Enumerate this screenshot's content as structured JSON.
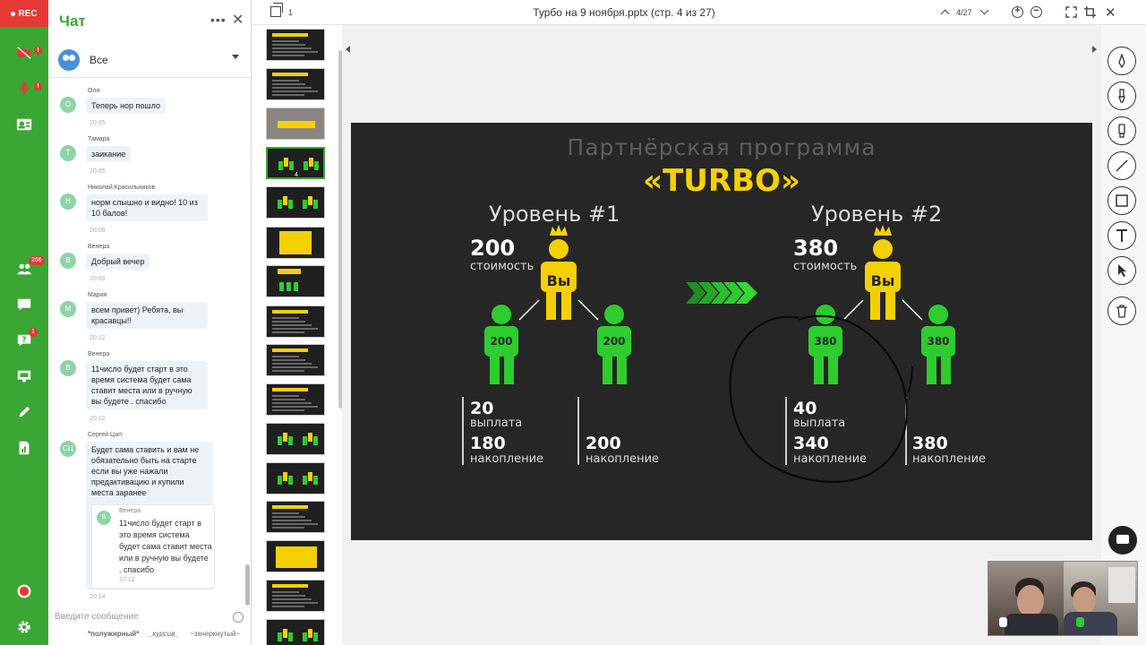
{
  "rail": {
    "rec_label": "REC",
    "users_badge": "266",
    "question_badge": "1"
  },
  "chat": {
    "title": "Чат",
    "recipient": "Все",
    "messages": [
      {
        "initial": "О",
        "author": "Оля",
        "text": "Теперь нор пошло",
        "time": "20:05"
      },
      {
        "initial": "Т",
        "author": "Тамара",
        "text": "заикание",
        "time": "20:05"
      },
      {
        "initial": "Н",
        "author": "Николай Красильников",
        "text": "норм слышно и видно! 10 из 10 балов!",
        "time": "20:08"
      },
      {
        "initial": "В",
        "author": "Венера",
        "text": "Добрый вечер",
        "time": "20:09"
      },
      {
        "initial": "М",
        "author": "Мария",
        "text": "всем привет) Ребята, вы красавцы!!",
        "time": "20:12"
      },
      {
        "initial": "В",
        "author": "Венера",
        "text": "11число будет старт в это время система будет сама ставит места или в ручную вы будете . спасибо",
        "time": "20:12"
      },
      {
        "initial": "СЦ",
        "author": "Сергей Цап",
        "text": "Будет сама ставить и вам не обязательно быть на старте если вы уже нажали предактивацию и купили места заранее",
        "time": "20:14",
        "quote": {
          "initial": "В",
          "author": "Венера",
          "text": "11число будет старт в это время система будет сама ставит места или в ручную вы будете . спасибо",
          "time": "17:12"
        }
      }
    ],
    "input_placeholder": "Введите сообщение",
    "format_bold": "*полужирный*",
    "format_italic": "_курсив_",
    "format_strike": "~зачеркнутый~"
  },
  "toolbar": {
    "pages_count": "1",
    "doc_title": "Турбо на 9 ноября.pptx (стр. 4 из 27)",
    "page_indicator": "4/27"
  },
  "thumbnails": [
    {
      "kind": "text",
      "title": "ПРЕИМУЩЕСТВА:"
    },
    {
      "kind": "text",
      "title": "ПРЕИМУЩЕСТВА:"
    },
    {
      "kind": "logo",
      "title": "«TURBO»"
    },
    {
      "kind": "levels",
      "num": "4",
      "active": true
    },
    {
      "kind": "levels"
    },
    {
      "kind": "promo"
    },
    {
      "kind": "people"
    },
    {
      "kind": "text"
    },
    {
      "kind": "text"
    },
    {
      "kind": "text"
    },
    {
      "kind": "levels"
    },
    {
      "kind": "levels"
    },
    {
      "kind": "text"
    },
    {
      "kind": "queue",
      "title": "ЖИВАЯ ОЧЕРЕДЬ"
    },
    {
      "kind": "text"
    },
    {
      "kind": "levels"
    }
  ],
  "slide": {
    "heading": "Партнёрская программа",
    "brand": "«TURBO»",
    "levels": [
      {
        "title": "Уровень #1",
        "cost_value": "200",
        "cost_label": "стоимость",
        "you": "Вы",
        "child_a": "200",
        "child_b": "200",
        "payout_value": "20",
        "payout_label": "выплата",
        "accum_value": "180",
        "accum_label": "накопление",
        "right_value": "200",
        "right_label": "накопление"
      },
      {
        "title": "Уровень #2",
        "cost_value": "380",
        "cost_label": "стоимость",
        "you": "Вы",
        "child_a": "380",
        "child_b": "380",
        "payout_value": "40",
        "payout_label": "выплата",
        "accum_value": "340",
        "accum_label": "накопление",
        "right_value": "380",
        "right_label": "накопление"
      }
    ]
  },
  "colors": {
    "rail_green": "#3aa634",
    "rec_red": "#e53935",
    "slide_bg": "#262626",
    "brand_yellow": "#f5d000",
    "figure_green": "#2ecc2e"
  },
  "icons": [
    "camera-off-icon",
    "mic-off-icon",
    "user-card-icon",
    "users-icon",
    "chat-icon",
    "question-icon",
    "presentation-icon",
    "pencil-icon",
    "report-icon",
    "status-ring-icon",
    "gear-icon",
    "pen-tool-icon",
    "brush-tool-icon",
    "marker-tool-icon",
    "line-tool-icon",
    "rect-tool-icon",
    "text-tool-icon",
    "pointer-tool-icon",
    "trash-icon"
  ]
}
